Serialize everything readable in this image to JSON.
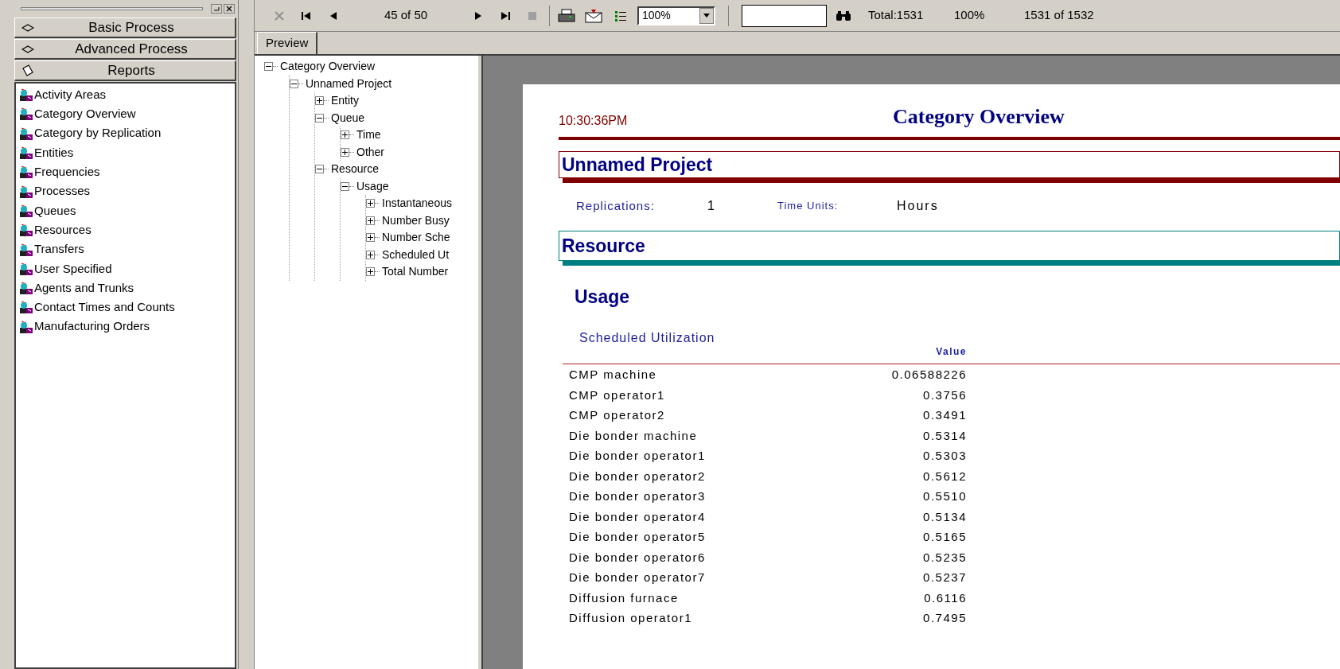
{
  "toolbar": {
    "page_indicator": "45 of 50",
    "zoom": "100%",
    "total": "Total:1531",
    "percent": "100%",
    "record": "1531 of 1532"
  },
  "sidebar": {
    "panels": [
      {
        "label": "Basic Process",
        "kind": "diamond"
      },
      {
        "label": "Advanced Process",
        "kind": "diamond"
      },
      {
        "label": "Reports",
        "kind": "reports"
      }
    ],
    "items": [
      "Activity Areas",
      "Category Overview",
      "Category by Replication",
      "Entities",
      "Frequencies",
      "Processes",
      "Queues",
      "Resources",
      "Transfers",
      "User Specified",
      "Agents and Trunks",
      "Contact Times and Counts",
      "Manufacturing Orders"
    ]
  },
  "tabs": [
    {
      "label": "Preview",
      "selected": true
    }
  ],
  "tree": [
    {
      "label": "Category Overview",
      "expanded": true,
      "children": [
        {
          "label": "Unnamed Project",
          "expanded": true,
          "children": [
            {
              "label": "Entity",
              "expanded": false
            },
            {
              "label": "Queue",
              "expanded": true,
              "children": [
                {
                  "label": "Time",
                  "expanded": false
                },
                {
                  "label": "Other",
                  "expanded": false
                }
              ]
            },
            {
              "label": "Resource",
              "expanded": true,
              "children": [
                {
                  "label": "Usage",
                  "expanded": true,
                  "children": [
                    {
                      "label": "Instantaneous",
                      "expanded": false
                    },
                    {
                      "label": "Number Busy",
                      "expanded": false
                    },
                    {
                      "label": "Number Sche",
                      "expanded": false
                    },
                    {
                      "label": "Scheduled Ut",
                      "expanded": false
                    },
                    {
                      "label": "Total Number",
                      "expanded": false
                    }
                  ]
                }
              ]
            }
          ]
        }
      ]
    }
  ],
  "report": {
    "time": "10:30:36PM",
    "title": "Category Overview",
    "project": {
      "title": "Unnamed Project",
      "color": "#800000"
    },
    "replications_label": "Replications:",
    "replications": "1",
    "time_units_label": "Time Units:",
    "time_units": "Hours",
    "section": {
      "title": "Resource",
      "color": "#008080"
    },
    "subsection": "Usage",
    "table": {
      "title": "Scheduled Utilization",
      "column": "Value",
      "rows": [
        [
          "CMP machine",
          "0.06588226"
        ],
        [
          "CMP operator1",
          "0.3756"
        ],
        [
          "CMP operator2",
          "0.3491"
        ],
        [
          "Die bonder machine",
          "0.5314"
        ],
        [
          "Die bonder operator1",
          "0.5303"
        ],
        [
          "Die bonder operator2",
          "0.5612"
        ],
        [
          "Die bonder operator3",
          "0.5510"
        ],
        [
          "Die bonder operator4",
          "0.5134"
        ],
        [
          "Die bonder operator5",
          "0.5165"
        ],
        [
          "Die bonder operator6",
          "0.5235"
        ],
        [
          "Die bonder operator7",
          "0.5237"
        ],
        [
          "Diffusion furnace",
          "0.6116"
        ],
        [
          "Diffusion operator1",
          "0.7495"
        ]
      ]
    }
  }
}
